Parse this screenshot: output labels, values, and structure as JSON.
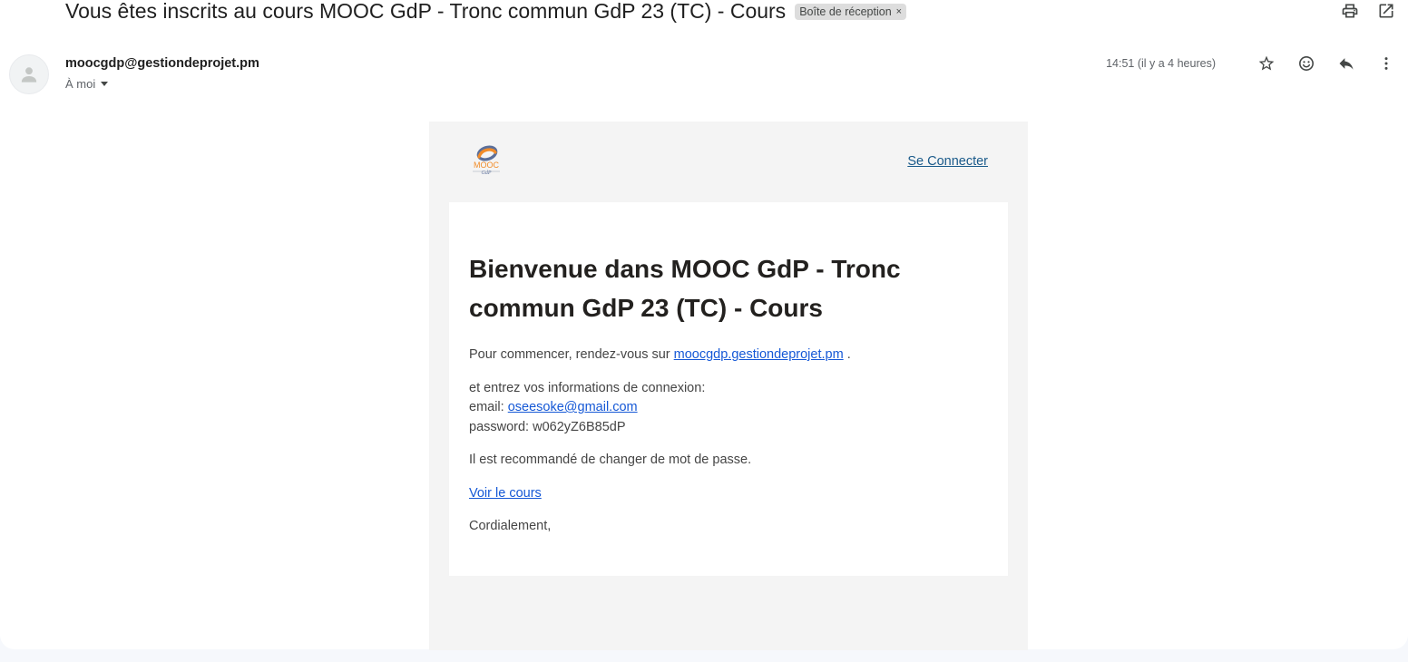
{
  "header": {
    "subject": "Vous êtes inscrits au cours MOOC GdP - Tronc commun GdP 23 (TC) - Cours",
    "label_chip": "Boîte de réception",
    "label_remove": "×"
  },
  "message": {
    "sender": "moocgdp@gestiondeprojet.pm",
    "recipient": "À moi",
    "time": "14:51 (il y a 4 heures)"
  },
  "email_body": {
    "logo_text": "MOOC",
    "logo_subtext": "GdP",
    "signin_link": "Se Connecter",
    "heading": "Bienvenue dans MOOC GdP - Tronc commun GdP 23 (TC) - Cours",
    "intro_prefix": "Pour commencer, rendez-vous sur",
    "site_link": "moocgdp.gestiondeprojet.pm",
    "intro_suffix": ".",
    "credentials_intro": "et entrez vos informations de connexion:",
    "email_label": "email:",
    "email_value": "oseesoke@gmail.com",
    "password_label": "password:",
    "password_value": "w062yZ6B85dP",
    "recommendation": "Il est recommandé de changer de mot de passe.",
    "course_link": "Voir le cours",
    "closing": "Cordialement,"
  },
  "icons": {
    "print": "print-icon",
    "open_new_window": "open-in-new-window-icon",
    "star": "star-icon",
    "emoji": "emoji-reaction-icon",
    "reply": "reply-icon",
    "more": "more-vertical-icon",
    "avatar": "default-avatar-icon"
  },
  "colors": {
    "link": "#1558d6",
    "signin_link": "#1a5a8a",
    "logo_orange": "#f28c28",
    "logo_blue": "#5b6f9a"
  }
}
